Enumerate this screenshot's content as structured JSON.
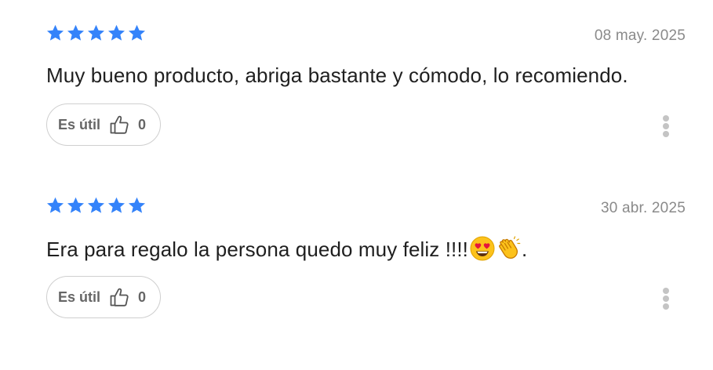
{
  "reviews": [
    {
      "rating": 5,
      "date": "08 may. 2025",
      "text": "Muy bueno producto, abriga bastante y cómodo, lo recomiendo.",
      "emojis": [],
      "useful_label": "Es útil",
      "useful_count": "0"
    },
    {
      "rating": 5,
      "date": "30 abr. 2025",
      "text": "Era para regalo la persona quedo muy feliz !!!!",
      "emojis": [
        "heart-eyes-emoji",
        "clapping-hands-emoji"
      ],
      "text_suffix": ".",
      "useful_label": "Es útil",
      "useful_count": "0"
    }
  ],
  "colors": {
    "star": "#3483fa",
    "date": "#8a8a8a",
    "button_border": "#cfcfcf",
    "button_text": "#666666",
    "dots": "#c4c4c4"
  },
  "icons": {
    "star": "star-icon",
    "thumb": "thumbs-up-icon",
    "more": "vertical-ellipsis-icon"
  }
}
